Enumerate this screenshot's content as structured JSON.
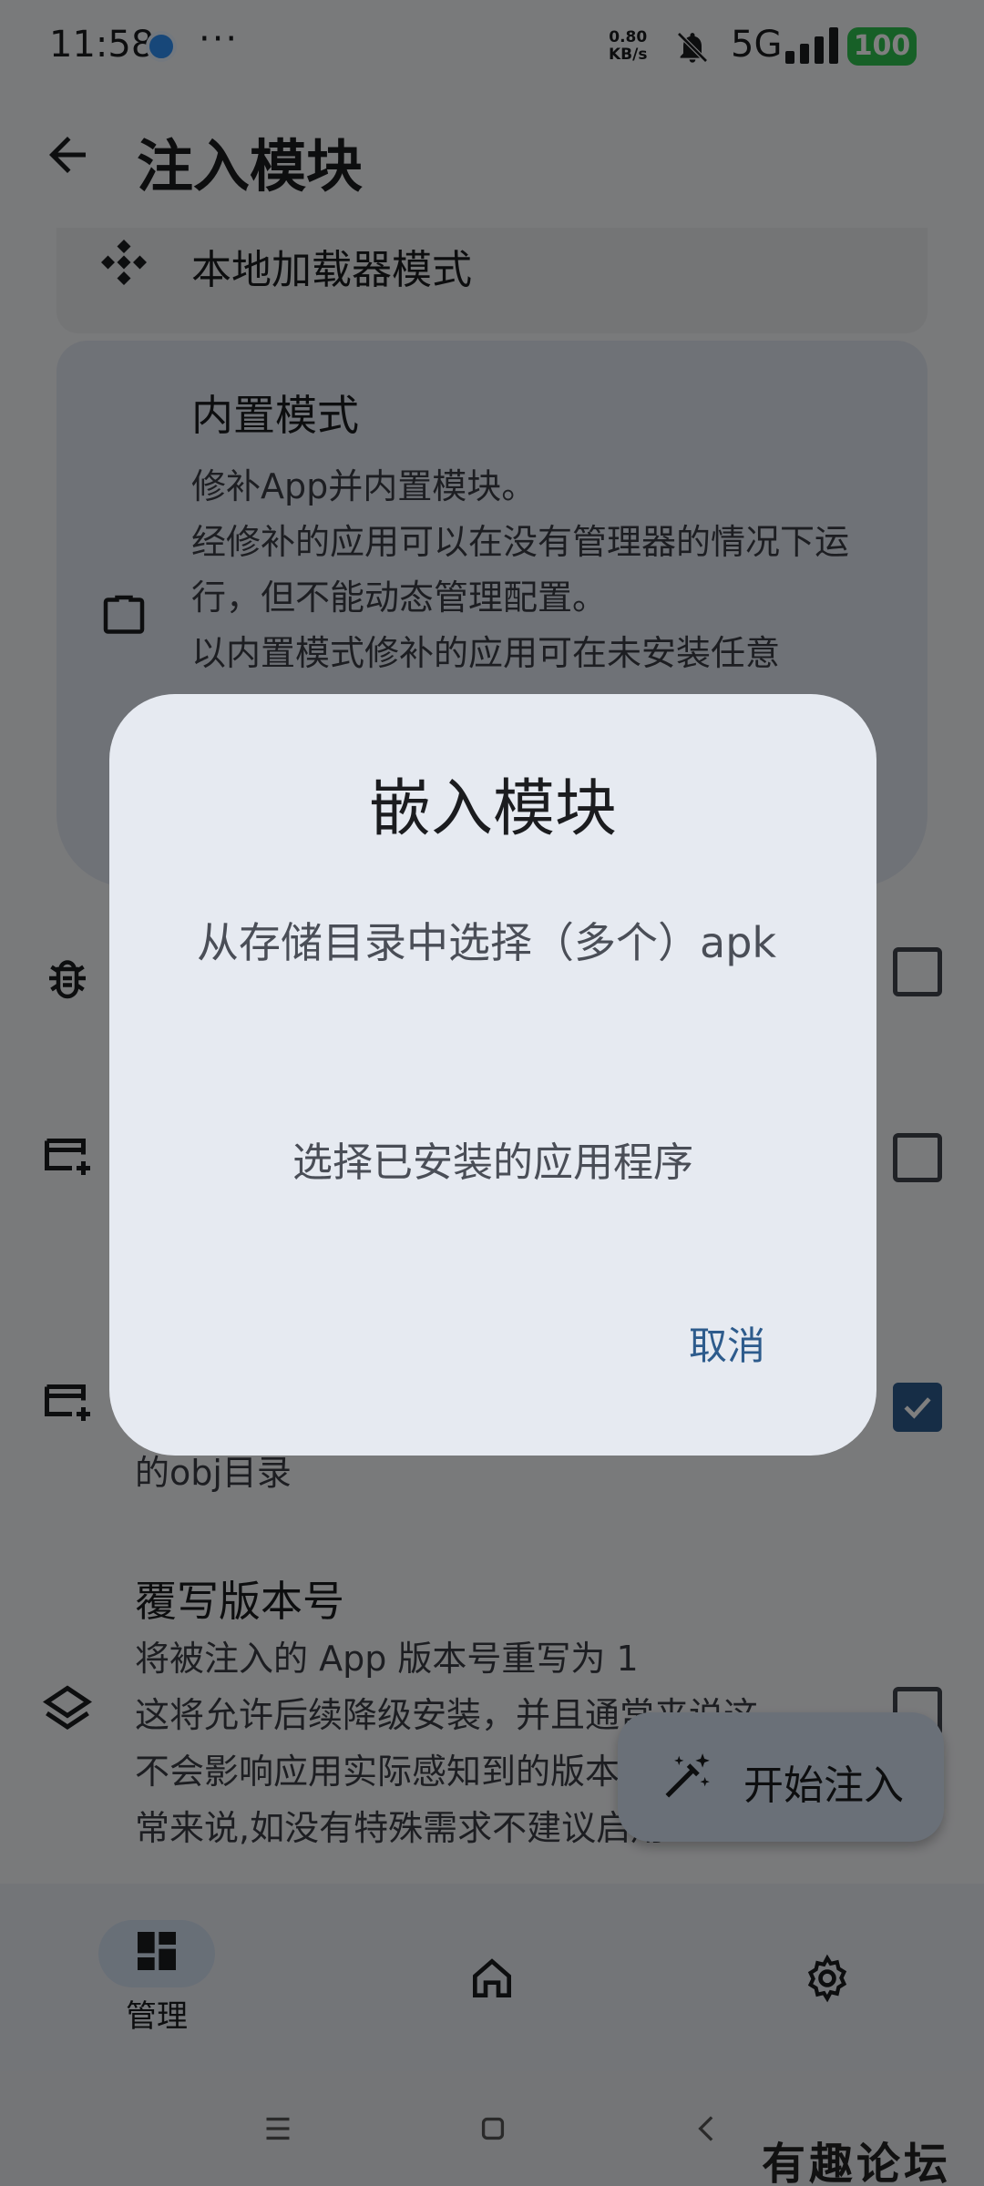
{
  "status_bar": {
    "time": "11:58",
    "dots": "···",
    "speed_value": "0.80",
    "speed_unit": "KB/s",
    "network": "5G",
    "battery": "100"
  },
  "app_bar": {
    "title": "注入模块"
  },
  "modes": {
    "local": {
      "label": "本地加载器模式"
    },
    "embedded": {
      "title": "内置模式",
      "desc_1": "修补App并内置模块。",
      "desc_2": "经修补的应用可以在没有管理器的情况下运行，但不能动态管理配置。",
      "desc_3": "以内置模式修补的应用可在未安装任意"
    }
  },
  "settings": {
    "obj_row_text": "的obj目录",
    "override": {
      "title": "覆写版本号",
      "desc_1": "将被注入的 App 版本号重写为 1",
      "desc_2": "这将允许后续降级安装，并且通常来说这",
      "desc_3": "不会影响应用实际感知到的版本号，通",
      "desc_4": "常来说,如没有特殊需求不建议启用"
    },
    "checkbox_states": [
      false,
      false,
      true,
      false
    ]
  },
  "fab": {
    "label": "开始注入"
  },
  "bottom_nav": {
    "manage_label": "管理"
  },
  "dialog": {
    "title": "嵌入模块",
    "option_storage": "从存储目录中选择（多个）apk",
    "option_installed": "选择已安装的应用程序",
    "cancel": "取消"
  },
  "watermark": "有趣论坛",
  "colors": {
    "accent": "#2d5b8c",
    "battery": "#2ec04f",
    "scrim": "rgba(0,0,0,0.5)"
  }
}
